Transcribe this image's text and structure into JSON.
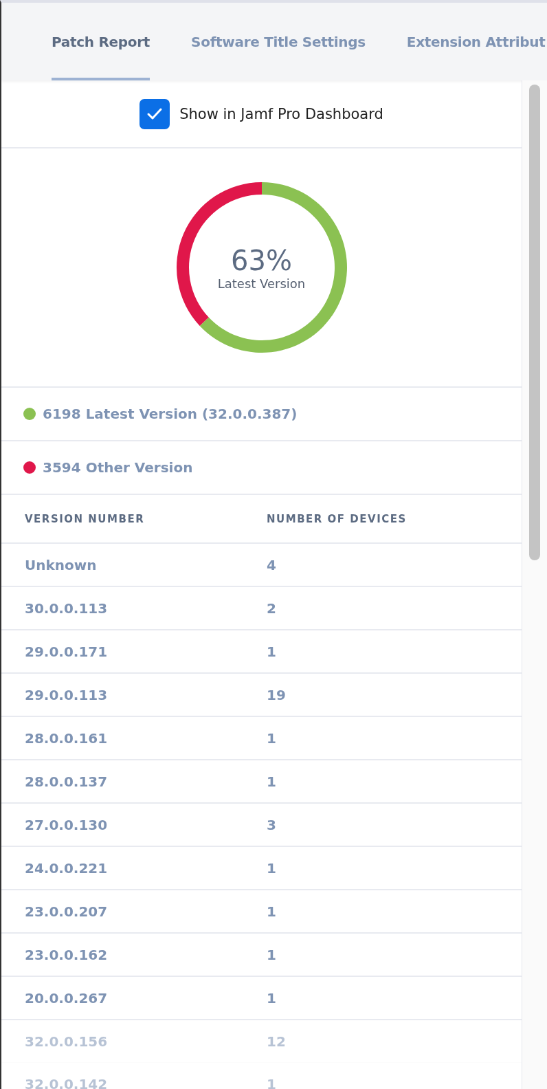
{
  "tabs": [
    {
      "label": "Patch Report",
      "selected": true
    },
    {
      "label": "Software Title Settings",
      "selected": false
    },
    {
      "label": "Extension Attribut",
      "selected": false
    }
  ],
  "dashboard_option": {
    "label": "Show in Jamf Pro Dashboard",
    "checked": true
  },
  "summary": {
    "percent": "63%",
    "caption": "Latest Version",
    "chart_data": {
      "type": "donut",
      "values": [
        63,
        37
      ]
    }
  },
  "legend": [
    {
      "label": "6198 Latest Version (32.0.0.387)",
      "color": "#8bc152"
    },
    {
      "label": "3594 Other Version",
      "color": "#e0174a"
    }
  ],
  "table": {
    "columns": [
      "VERSION NUMBER",
      "NUMBER OF DEVICES"
    ],
    "rows": [
      {
        "cells": [
          "Unknown",
          "4"
        ],
        "faded": false
      },
      {
        "cells": [
          "30.0.0.113",
          "2"
        ],
        "faded": false
      },
      {
        "cells": [
          "29.0.0.171",
          "1"
        ],
        "faded": false
      },
      {
        "cells": [
          "29.0.0.113",
          "19"
        ],
        "faded": false
      },
      {
        "cells": [
          "28.0.0.161",
          "1"
        ],
        "faded": false
      },
      {
        "cells": [
          "28.0.0.137",
          "1"
        ],
        "faded": false
      },
      {
        "cells": [
          "27.0.0.130",
          "3"
        ],
        "faded": false
      },
      {
        "cells": [
          "24.0.0.221",
          "1"
        ],
        "faded": false
      },
      {
        "cells": [
          "23.0.0.207",
          "1"
        ],
        "faded": false
      },
      {
        "cells": [
          "23.0.0.162",
          "1"
        ],
        "faded": false
      },
      {
        "cells": [
          "20.0.0.267",
          "1"
        ],
        "faded": false
      },
      {
        "cells": [
          "32.0.0.156",
          "12"
        ],
        "faded": true
      },
      {
        "cells": [
          "32.0.0.142",
          "1"
        ],
        "faded": true
      }
    ]
  }
}
